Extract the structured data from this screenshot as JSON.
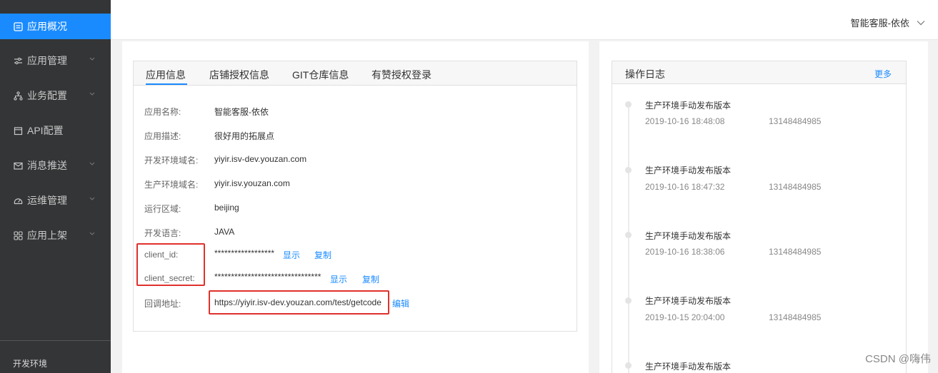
{
  "sidebar": {
    "items": [
      {
        "label": "应用概况",
        "icon": "app-overview-icon",
        "active": true
      },
      {
        "label": "应用管理",
        "icon": "sliders-icon",
        "expandable": true
      },
      {
        "label": "业务配置",
        "icon": "org-tree-icon",
        "expandable": true
      },
      {
        "label": "API配置",
        "icon": "calendar-icon",
        "expandable": false
      },
      {
        "label": "消息推送",
        "icon": "mail-icon",
        "expandable": true
      },
      {
        "label": "运维管理",
        "icon": "gauge-icon",
        "expandable": true
      },
      {
        "label": "应用上架",
        "icon": "grid-icon",
        "expandable": true
      }
    ],
    "env_label": "开发环境"
  },
  "topbar": {
    "app_name": "智能客服-依依"
  },
  "tabs": [
    "应用信息",
    "店铺授权信息",
    "GIT仓库信息",
    "有赞授权登录"
  ],
  "app_info": {
    "fields": [
      {
        "label": "应用名称:",
        "value": "智能客服-依依"
      },
      {
        "label": "应用描述:",
        "value": "很好用的拓展点"
      },
      {
        "label": "开发环境域名:",
        "value": "yiyir.isv-dev.youzan.com"
      },
      {
        "label": "生产环境域名:",
        "value": "yiyir.isv.youzan.com"
      },
      {
        "label": "运行区域:",
        "value": "beijing"
      },
      {
        "label": "开发语言:",
        "value": "JAVA"
      },
      {
        "label": "client_id:",
        "value": "******************"
      },
      {
        "label": "client_secret:",
        "value": "********************************"
      },
      {
        "label": "回调地址:",
        "value": "https://yiyir.isv-dev.youzan.com/test/getcode"
      }
    ],
    "show_label": "显示",
    "copy_label": "复制",
    "edit_label": "编辑"
  },
  "log": {
    "title": "操作日志",
    "more": "更多",
    "entries": [
      {
        "title": "生产环境手动发布版本",
        "time": "2019-10-16 18:48:08",
        "user": "13148484985"
      },
      {
        "title": "生产环境手动发布版本",
        "time": "2019-10-16 18:47:32",
        "user": "13148484985"
      },
      {
        "title": "生产环境手动发布版本",
        "time": "2019-10-16 18:38:06",
        "user": "13148484985"
      },
      {
        "title": "生产环境手动发布版本",
        "time": "2019-10-15 20:04:00",
        "user": "13148484985"
      },
      {
        "title": "生产环境手动发布版本",
        "time": "",
        "user": ""
      }
    ]
  },
  "watermark": "CSDN @嗨伟",
  "colors": {
    "accent": "#1a8bff",
    "sidebar_bg": "#343536",
    "highlight_box": "#e0312c"
  }
}
